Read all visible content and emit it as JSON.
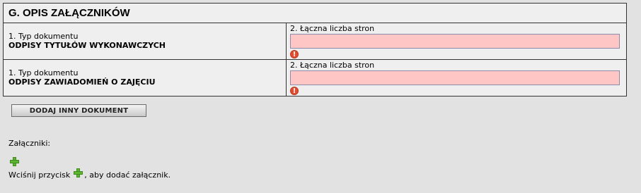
{
  "section": {
    "title": "G. OPIS ZAŁĄCZNIKÓW"
  },
  "documents": [
    {
      "type_label": "1. Typ dokumentu",
      "type_value": "ODPISY TYTUŁÓW WYKONAWCZYCH",
      "pages_label": "2. Łączna liczba stron",
      "pages_value": ""
    },
    {
      "type_label": "1. Typ dokumentu",
      "type_value": "ODPISY ZAWIADOMIEŃ O ZAJĘCIU",
      "pages_label": "2. Łączna liczba stron",
      "pages_value": ""
    }
  ],
  "add_document_button": "DODAJ INNY DOKUMENT",
  "attachments": {
    "label": "Załączniki:",
    "hint_before": "Wciśnij przycisk",
    "hint_after": ", aby dodać załącznik."
  },
  "icons": {
    "error": "exclamation-circle-icon",
    "add": "plus-icon"
  },
  "colors": {
    "invalid_input_bg": "#ffc6c6",
    "error_icon": "#e44b2f",
    "add_icon": "#5db531"
  }
}
